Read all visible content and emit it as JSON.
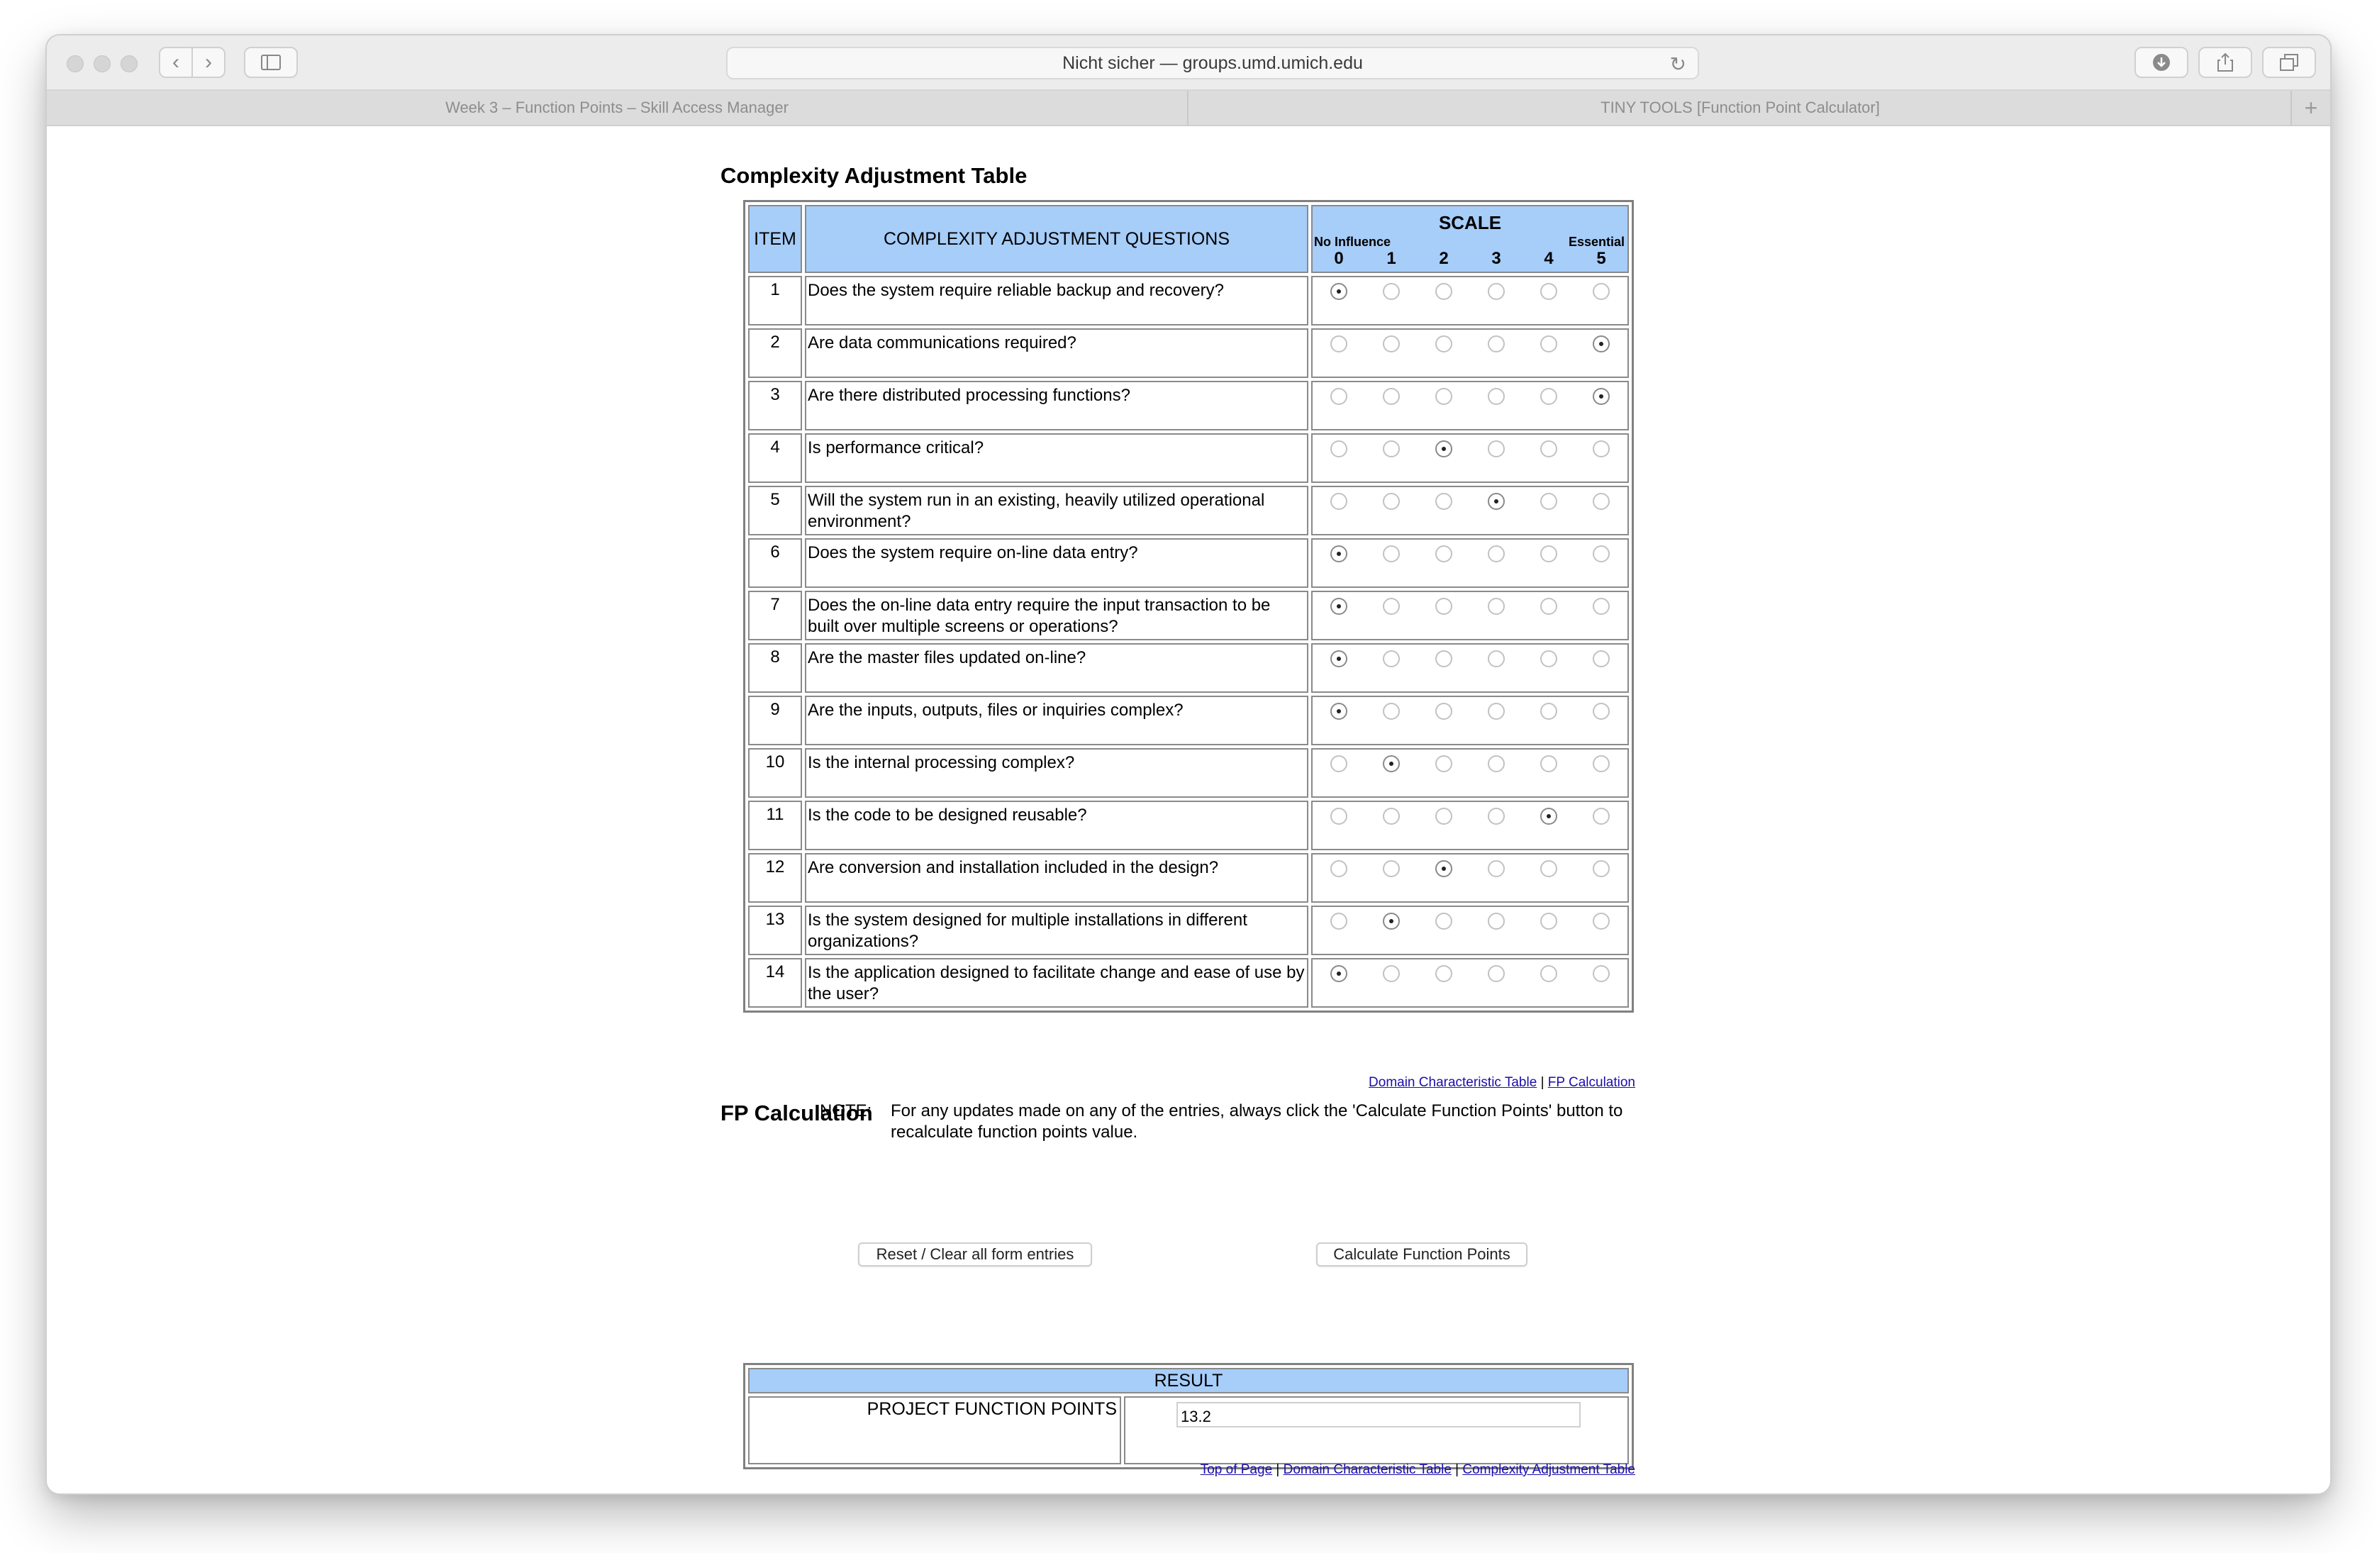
{
  "browser": {
    "address": "Nicht sicher — groups.umd.umich.edu",
    "tabs": [
      "Week 3 – Function Points – Skill Access Manager",
      "TINY TOOLS [Function Point Calculator]"
    ]
  },
  "complexity": {
    "heading": "Complexity Adjustment Table",
    "col_item": "ITEM",
    "col_questions": "COMPLEXITY ADJUSTMENT QUESTIONS",
    "scale_title": "SCALE",
    "scale_low": "No Influence",
    "scale_high": "Essential",
    "scale_values": [
      "0",
      "1",
      "2",
      "3",
      "4",
      "5"
    ],
    "rows": [
      {
        "item": "1",
        "question": "Does the system require reliable backup and recovery?",
        "selected": 0
      },
      {
        "item": "2",
        "question": "Are data communications required?",
        "selected": 5
      },
      {
        "item": "3",
        "question": "Are there distributed processing functions?",
        "selected": 5
      },
      {
        "item": "4",
        "question": "Is performance critical?",
        "selected": 2
      },
      {
        "item": "5",
        "question": "Will the system run in an existing, heavily utilized operational environment?",
        "selected": 3
      },
      {
        "item": "6",
        "question": "Does the system require on-line data entry?",
        "selected": 0
      },
      {
        "item": "7",
        "question": "Does the on-line data entry require the input transaction to be built over multiple screens or operations?",
        "selected": 0
      },
      {
        "item": "8",
        "question": "Are the master files updated on-line?",
        "selected": 0
      },
      {
        "item": "9",
        "question": "Are the inputs, outputs, files or inquiries complex?",
        "selected": 0
      },
      {
        "item": "10",
        "question": "Is the internal processing complex?",
        "selected": 1
      },
      {
        "item": "11",
        "question": "Is the code to be designed reusable?",
        "selected": 4
      },
      {
        "item": "12",
        "question": "Are conversion and installation included in the design?",
        "selected": 2
      },
      {
        "item": "13",
        "question": "Is the system designed for multiple installations in different organizations?",
        "selected": 1
      },
      {
        "item": "14",
        "question": "Is the application designed to facilitate change and ease of use by the user?",
        "selected": 0
      }
    ],
    "link_domain": "Domain Characteristic Table",
    "link_fp": "FP Calculation",
    "separator": "|"
  },
  "fp": {
    "heading": "FP Calculation",
    "note_label": "NOTE:",
    "note_text": "For any updates made on any of the entries, always click the 'Calculate Function Points' button to recalculate function points value.",
    "reset_button": "Reset / Clear all form entries",
    "calc_button": "Calculate Function Points",
    "result_header": "RESULT",
    "result_label": "PROJECT FUNCTION POINTS",
    "result_value": "13.2",
    "link_top": "Top of Page",
    "link_domain": "Domain Characteristic Table",
    "link_complexity": "Complexity Adjustment Table"
  }
}
